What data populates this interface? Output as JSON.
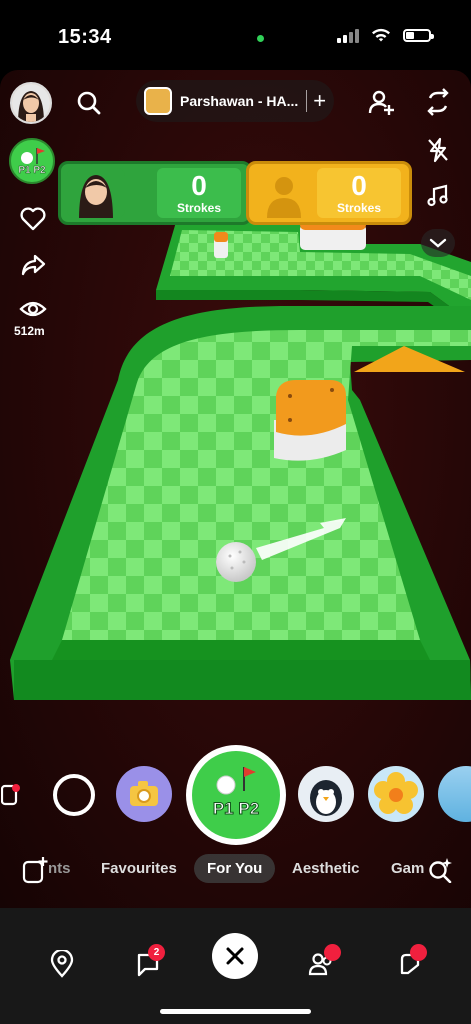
{
  "status_bar": {
    "time": "15:34"
  },
  "top_bar": {
    "lens_name": "Parshawan - HA...",
    "add_symbol": "+"
  },
  "left_rail": {
    "views": "512m"
  },
  "lens_badge": {
    "label": "P1 P2"
  },
  "game": {
    "player1": {
      "score": "0",
      "score_label": "Strokes"
    },
    "player2": {
      "score": "0",
      "score_label": "Strokes"
    }
  },
  "carousel": {
    "selected_lens_label": "P1 P2"
  },
  "category_tabs": [
    {
      "label": "nts"
    },
    {
      "label": "Favourites"
    },
    {
      "label": "For You"
    },
    {
      "label": "Aesthetic"
    },
    {
      "label": "Gam"
    }
  ],
  "bottom_nav": {
    "chat_badge": "2"
  },
  "colors": {
    "accent_green": "#3fcd4a",
    "accent_yellow": "#f2b21c",
    "badge_red": "#f0203e"
  },
  "icons": [
    "search-icon",
    "add-friend-icon",
    "flip-camera-icon",
    "flash-off-icon",
    "music-icon",
    "chevron-down-icon",
    "heart-icon",
    "share-icon",
    "eye-icon",
    "map-icon",
    "chat-icon",
    "close-icon",
    "friends-icon",
    "stories-icon",
    "lens-search-icon",
    "memories-icon"
  ]
}
